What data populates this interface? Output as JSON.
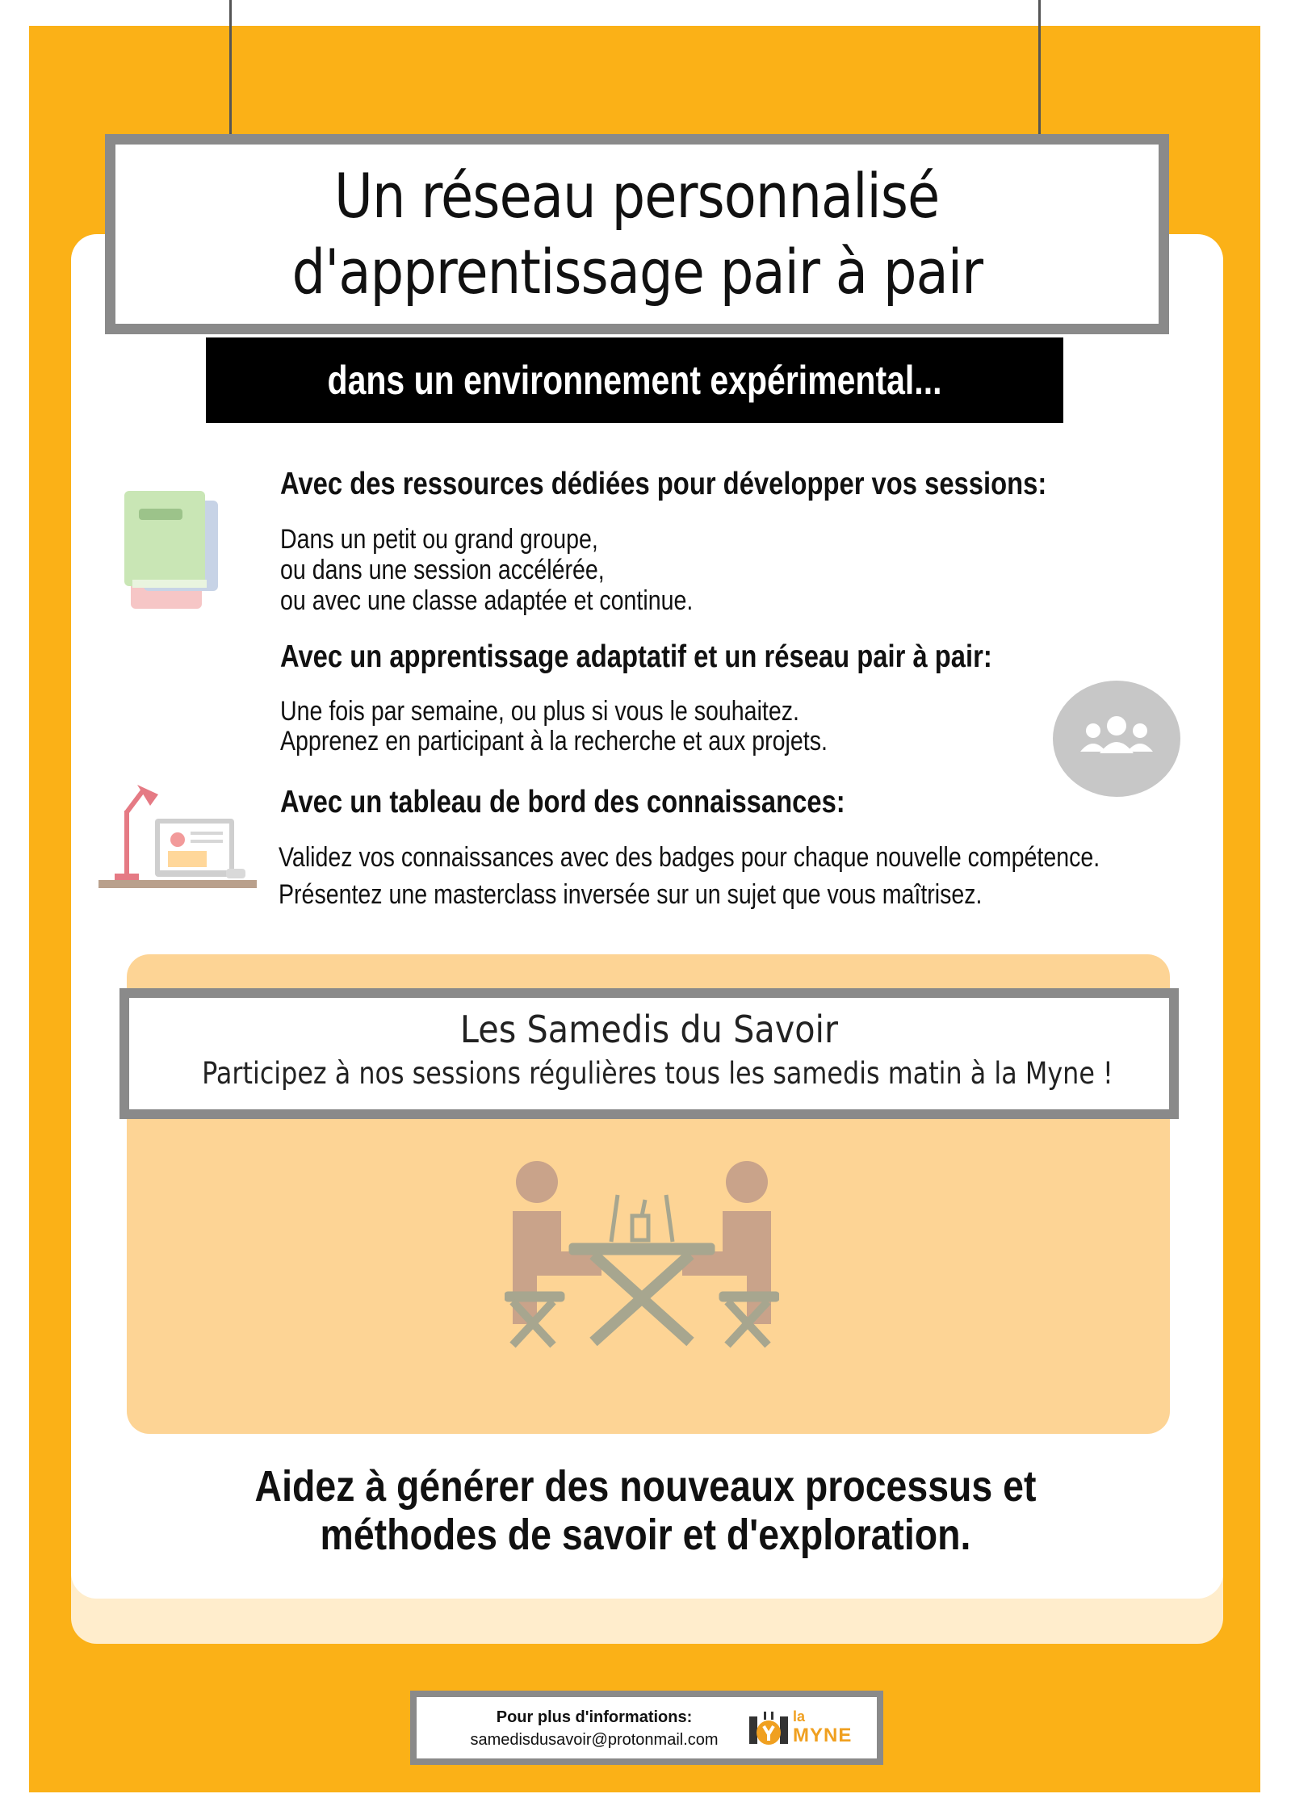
{
  "title": {
    "line1": "Un réseau personnalisé",
    "line2": "d'apprentissage pair à pair"
  },
  "subtitle": "dans un environnement expérimental...",
  "sections": [
    {
      "heading": "Avec des ressources dédiées pour développer vos sessions:",
      "lines": [
        "Dans un petit ou grand groupe,",
        "ou dans une session accélérée,",
        "ou avec une classe adaptée et continue."
      ],
      "icon": "books-icon"
    },
    {
      "heading": "Avec un apprentissage adaptatif et un réseau pair à pair:",
      "lines": [
        "Une fois par semaine, ou plus si vous le souhaitez.",
        "Apprenez en participant à la recherche et aux projets."
      ],
      "icon": "group-icon"
    },
    {
      "heading": "Avec un tableau de bord des connaissances:",
      "lines": [
        "Validez vos connaissances avec des badges pour chaque nouvelle compétence.",
        "Présentez une masterclass inversée sur un sujet que vous maîtrisez."
      ],
      "icon": "desk-lamp-icon"
    }
  ],
  "samedis": {
    "title": "Les Samedis du Savoir",
    "subtitle": "Participez à nos sessions régulières tous les samedis matin à la Myne !",
    "icon": "people-at-table-icon"
  },
  "call_to_action": {
    "line1": "Aidez à générer des nouveaux processus et",
    "line2": "méthodes de savoir et d'exploration."
  },
  "footer": {
    "label": "Pour plus d'informations:",
    "email": "samedisdusavoir@protonmail.com",
    "logo_small": "la",
    "logo_big": "MYNE"
  },
  "colors": {
    "background": "#fbb117",
    "panel": "#fdd495",
    "frame": "#8a8a8a"
  }
}
